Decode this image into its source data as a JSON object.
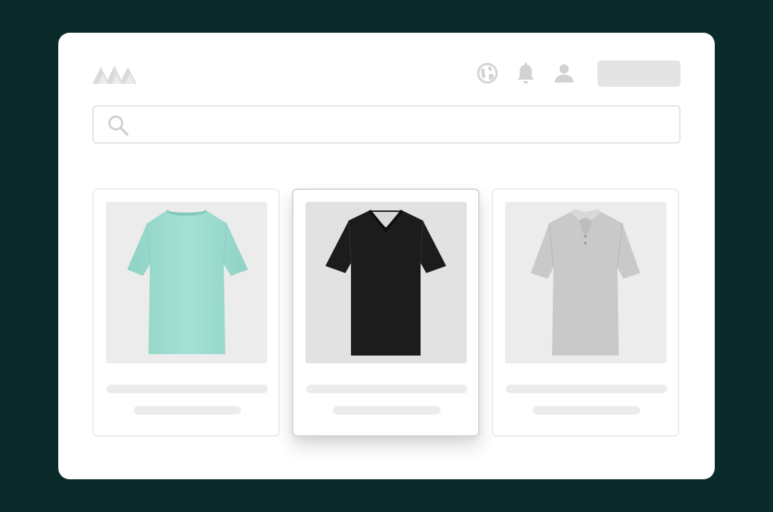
{
  "header": {
    "logo": "mountain-logo",
    "icons": [
      "globe-icon",
      "bell-icon",
      "user-icon"
    ],
    "button_label": ""
  },
  "search": {
    "icon": "search-icon",
    "placeholder": "",
    "value": ""
  },
  "products": [
    {
      "item": "tshirt-mint",
      "color": "#9fdcd0",
      "selected": false
    },
    {
      "item": "tshirt-black-vneck",
      "color": "#1b1b1b",
      "selected": true
    },
    {
      "item": "polo-grey",
      "color": "#c9c9c9",
      "selected": false
    }
  ],
  "colors": {
    "background": "#0b2b2b",
    "window": "#ffffff",
    "placeholder": "#ececec",
    "icon": "#d4d4d4"
  }
}
